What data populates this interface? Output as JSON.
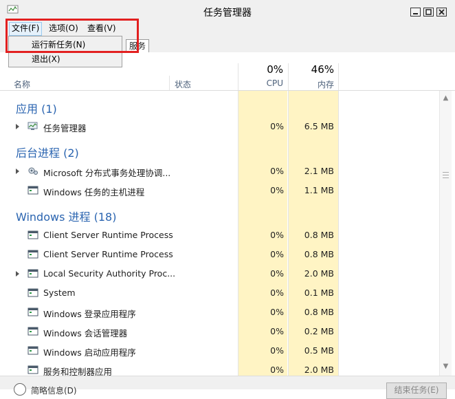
{
  "window": {
    "title": "任务管理器"
  },
  "menubar": {
    "file": "文件(F)",
    "options": "选项(O)",
    "view": "查看(V)"
  },
  "file_menu": {
    "items": [
      "运行新任务(N)",
      "退出(X)"
    ]
  },
  "tabs": {
    "services": "服务"
  },
  "columns": {
    "name": "名称",
    "status": "状态",
    "cpu": {
      "percent": "0%",
      "label": "CPU"
    },
    "memory": {
      "percent": "46%",
      "label": "内存"
    }
  },
  "groups": [
    {
      "title": "应用 (1)"
    },
    {
      "title": "后台进程 (2)"
    },
    {
      "title": "Windows 进程 (18)"
    }
  ],
  "rows": [
    {
      "name": "任务管理器",
      "cpu": "0%",
      "mem": "6.5 MB",
      "icon": "task-manager-icon",
      "expandable": true
    },
    {
      "name": "Microsoft 分布式事务处理协调...",
      "cpu": "0%",
      "mem": "2.1 MB",
      "icon": "gear-process-icon",
      "expandable": true
    },
    {
      "name": "Windows 任务的主机进程",
      "cpu": "0%",
      "mem": "1.1 MB",
      "icon": "window-process-icon",
      "expandable": false
    },
    {
      "name": "Client Server Runtime Process",
      "cpu": "0%",
      "mem": "0.8 MB",
      "icon": "window-process-icon",
      "expandable": false
    },
    {
      "name": "Client Server Runtime Process",
      "cpu": "0%",
      "mem": "0.8 MB",
      "icon": "window-process-icon",
      "expandable": false
    },
    {
      "name": "Local Security Authority Proc...",
      "cpu": "0%",
      "mem": "2.0 MB",
      "icon": "window-process-icon",
      "expandable": true
    },
    {
      "name": "System",
      "cpu": "0%",
      "mem": "0.1 MB",
      "icon": "window-process-icon",
      "expandable": false
    },
    {
      "name": "Windows 登录应用程序",
      "cpu": "0%",
      "mem": "0.8 MB",
      "icon": "window-process-icon",
      "expandable": false
    },
    {
      "name": "Windows 会话管理器",
      "cpu": "0%",
      "mem": "0.2 MB",
      "icon": "window-process-icon",
      "expandable": false
    },
    {
      "name": "Windows 启动应用程序",
      "cpu": "0%",
      "mem": "0.5 MB",
      "icon": "window-process-icon",
      "expandable": false
    },
    {
      "name": "服务和控制器应用",
      "cpu": "0%",
      "mem": "2.0 MB",
      "icon": "window-process-icon",
      "expandable": false
    }
  ],
  "footer": {
    "details": "简略信息(D)",
    "end_task": "结束任务(E)"
  },
  "colors": {
    "accent": "#2a64b0",
    "column_highlight": "#fff4c4",
    "callout": "#e22020"
  }
}
